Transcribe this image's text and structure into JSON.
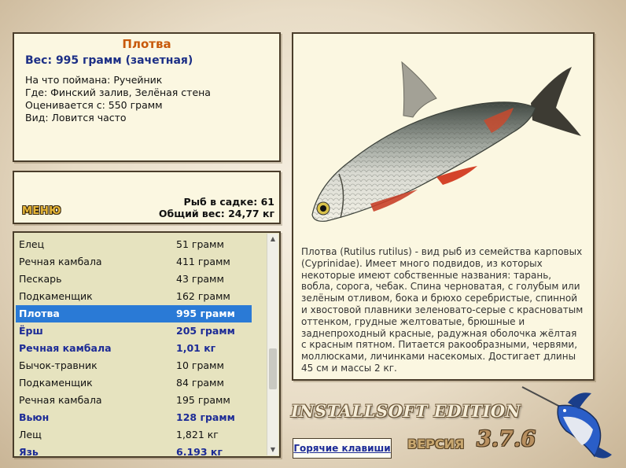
{
  "info": {
    "fish_name": "Плотва",
    "weight": "Вес: 995 грамм (зачетная)",
    "details": [
      "На что поймана: Ручейник",
      "Где: Финский залив, Зелёная стена",
      "Оценивается с: 550 грамм",
      "Вид: Ловится часто"
    ]
  },
  "status": {
    "menu_label": "МЕНЮ",
    "fish_in_keepnet": "Рыб в садке: 61",
    "total_weight": "Общий вес: 24,77 кг"
  },
  "catch_list": [
    {
      "name": "Елец",
      "weight": "51 грамм",
      "bold": false,
      "selected": false
    },
    {
      "name": "Речная камбала",
      "weight": "411 грамм",
      "bold": false,
      "selected": false
    },
    {
      "name": "Пескарь",
      "weight": "43 грамм",
      "bold": false,
      "selected": false
    },
    {
      "name": "Подкаменщик",
      "weight": "162 грамм",
      "bold": false,
      "selected": false
    },
    {
      "name": "Плотва",
      "weight": "995 грамм",
      "bold": true,
      "selected": true
    },
    {
      "name": "Ёрш",
      "weight": "205 грамм",
      "bold": true,
      "selected": false
    },
    {
      "name": "Речная камбала",
      "weight": "1,01 кг",
      "bold": true,
      "selected": false
    },
    {
      "name": "Бычок-травник",
      "weight": "10 грамм",
      "bold": false,
      "selected": false
    },
    {
      "name": "Подкаменщик",
      "weight": "84 грамм",
      "bold": false,
      "selected": false
    },
    {
      "name": "Речная камбала",
      "weight": "195 грамм",
      "bold": false,
      "selected": false
    },
    {
      "name": "Вьюн",
      "weight": "128 грамм",
      "bold": true,
      "selected": false
    },
    {
      "name": "Лещ",
      "weight": "1,821 кг",
      "bold": false,
      "selected": false
    },
    {
      "name": "Язь",
      "weight": "6.193 кг",
      "bold": true,
      "selected": false
    }
  ],
  "description": "Плотва (Rutilus rutilus) - вид рыб из семейства карповых (Cyprinidae). Имеет много подвидов, из которых некоторые имеют собственные названия: тарань, вобла, сорога, чебак. Спина черноватая, с голубым или зелёным отливом, бока и брюхо серебристые, спинной и хвостовой плавники зеленовато-серые с красноватым оттенком, грудные желтоватые, брюшные и заднепроходный красные, радужная оболочка жёлтая с красным пятном. Питается ракообразными, червями, моллюсками, личинками насекомых. Достигает длины 45 см и массы 2 кг.",
  "footer": {
    "brand": "INSTALLSOFT EDITION",
    "hotkeys_label": "Горячие клавиши",
    "version_label": "ВЕРСИЯ",
    "version_number": "3.7.6"
  },
  "icons": {
    "fish_picture": "roach-fish-image",
    "logo": "marlin-logo"
  },
  "colors": {
    "fish_name": "#c8590a",
    "accent_blue": "#1c2b96",
    "selected_row": "#2a7ad6",
    "panel_bg": "#fbf7e1",
    "list_bg": "#e6e3bf"
  }
}
